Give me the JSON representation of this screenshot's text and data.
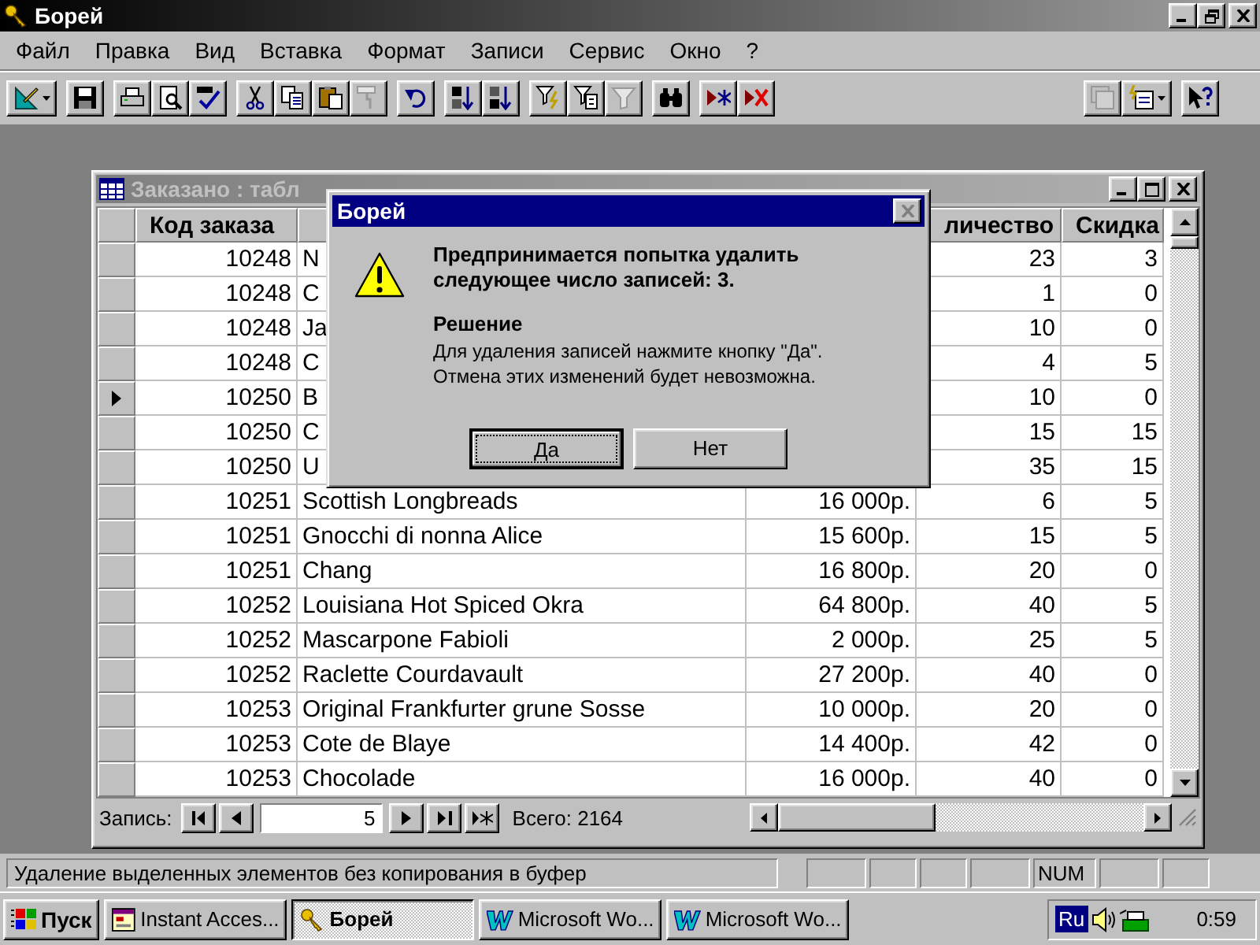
{
  "window": {
    "title": "Борей"
  },
  "menu": [
    "Файл",
    "Правка",
    "Вид",
    "Вставка",
    "Формат",
    "Записи",
    "Сервис",
    "Окно",
    "?"
  ],
  "toolbar": [
    [
      {
        "kind": "view",
        "dropdown": true,
        "disabled": false
      }
    ],
    [
      {
        "kind": "save",
        "disabled": false
      }
    ],
    [
      {
        "kind": "print",
        "disabled": false
      },
      {
        "kind": "preview",
        "disabled": false
      },
      {
        "kind": "spelling",
        "disabled": false
      }
    ],
    [
      {
        "kind": "cut",
        "disabled": false
      },
      {
        "kind": "copy",
        "disabled": false
      },
      {
        "kind": "paste",
        "disabled": false
      },
      {
        "kind": "painter",
        "disabled": true
      }
    ],
    [
      {
        "kind": "undo",
        "disabled": false
      }
    ],
    [
      {
        "kind": "sortasc",
        "disabled": false
      },
      {
        "kind": "sortdesc",
        "disabled": false
      }
    ],
    [
      {
        "kind": "filtersel",
        "disabled": false
      },
      {
        "kind": "filterform",
        "disabled": false
      },
      {
        "kind": "filter",
        "disabled": true
      }
    ],
    [
      {
        "kind": "find",
        "disabled": false
      }
    ],
    [
      {
        "kind": "newrec",
        "disabled": false
      },
      {
        "kind": "delrec",
        "disabled": false
      }
    ],
    [
      {
        "kind": "database",
        "disabled": true
      },
      {
        "kind": "newobject",
        "dropdown": true,
        "disabled": false
      }
    ],
    [
      {
        "kind": "help",
        "disabled": false
      }
    ]
  ],
  "table_window": {
    "title": "Заказано : табл",
    "columns": {
      "order": "Код заказа",
      "quantity": "личество",
      "discount": "Скидка"
    },
    "rows": [
      {
        "order": "10248",
        "product": "N",
        "quantity": "23",
        "discount": "3",
        "current": false
      },
      {
        "order": "10248",
        "product": "C",
        "quantity": "1",
        "discount": "0",
        "current": false
      },
      {
        "order": "10248",
        "product": "Ja",
        "quantity": "10",
        "discount": "0",
        "current": false
      },
      {
        "order": "10248",
        "product": "C",
        "quantity": "4",
        "discount": "5",
        "current": false
      },
      {
        "order": "10250",
        "product": "B",
        "quantity": "10",
        "discount": "0",
        "current": true
      },
      {
        "order": "10250",
        "product": "C",
        "quantity": "15",
        "discount": "15",
        "current": false
      },
      {
        "order": "10250",
        "product": "U",
        "quantity": "35",
        "discount": "15",
        "current": false
      },
      {
        "order": "10251",
        "product": "Scottish Longbreads",
        "price": "16 000р.",
        "quantity": "6",
        "discount": "5",
        "current": false
      },
      {
        "order": "10251",
        "product": "Gnocchi di nonna Alice",
        "price": "15 600р.",
        "quantity": "15",
        "discount": "5",
        "current": false
      },
      {
        "order": "10251",
        "product": "Chang",
        "price": "16 800р.",
        "quantity": "20",
        "discount": "0",
        "current": false
      },
      {
        "order": "10252",
        "product": "Louisiana Hot Spiced Okra",
        "price": "64 800р.",
        "quantity": "40",
        "discount": "5",
        "current": false
      },
      {
        "order": "10252",
        "product": "Mascarpone Fabioli",
        "price": "2 000р.",
        "quantity": "25",
        "discount": "5",
        "current": false
      },
      {
        "order": "10252",
        "product": "Raclette Courdavault",
        "price": "27 200р.",
        "quantity": "40",
        "discount": "0",
        "current": false
      },
      {
        "order": "10253",
        "product": "Original Frankfurter grune Sosse",
        "price": "10 000р.",
        "quantity": "20",
        "discount": "0",
        "current": false
      },
      {
        "order": "10253",
        "product": "Cote de Blaye",
        "price": "14 400р.",
        "quantity": "42",
        "discount": "0",
        "current": false
      },
      {
        "order": "10253",
        "product": "Chocolade",
        "price": "16 000р.",
        "quantity": "40",
        "discount": "0",
        "current": false
      }
    ],
    "navigator": {
      "label": "Запись:",
      "record": "5",
      "total": "Всего: 2164"
    }
  },
  "dialog": {
    "title": "Борей",
    "message": "Предпринимается попытка удалить следующее число записей: 3.",
    "heading": "Решение",
    "lines": [
      "Для удаления записей нажмите кнопку \"Да\".",
      "Отмена этих изменений будет невозможна."
    ],
    "buttons": [
      {
        "label": "Да",
        "default": true
      },
      {
        "label": "Нет",
        "default": false
      }
    ]
  },
  "status_bar": {
    "text": "Удаление выделенных элементов без копирования в буфер",
    "indicator": "NUM"
  },
  "taskbar": {
    "start": "Пуск",
    "tasks": [
      {
        "label": "Instant Acces...",
        "kind": "access",
        "selected": false
      },
      {
        "label": "Борей",
        "kind": "key",
        "selected": true
      },
      {
        "label": "Microsoft Wo...",
        "kind": "word",
        "selected": false
      },
      {
        "label": "Microsoft Wo...",
        "kind": "word",
        "selected": false
      }
    ],
    "language": "Ru",
    "clock": "0:59"
  }
}
